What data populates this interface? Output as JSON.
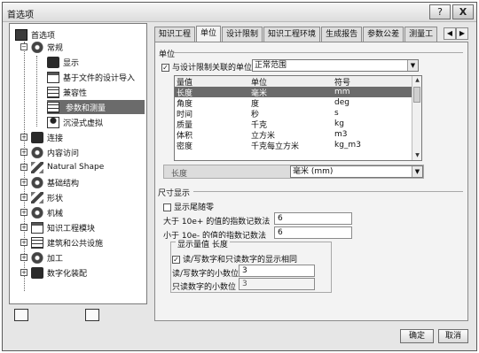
{
  "window": {
    "title": "首选项"
  },
  "tree": {
    "items": [
      {
        "label": "首选项"
      },
      {
        "label": "常规"
      },
      {
        "label": "显示"
      },
      {
        "label": "基于文件的设计导入"
      },
      {
        "label": "兼容性"
      },
      {
        "label": "参数和测量"
      },
      {
        "label": "沉浸式虚拟"
      },
      {
        "label": "连接"
      },
      {
        "label": "内容访问"
      },
      {
        "label": "Natural Shape"
      },
      {
        "label": "基础结构"
      },
      {
        "label": "形状"
      },
      {
        "label": "机械"
      },
      {
        "label": "知识工程模块"
      },
      {
        "label": "建筑和公共设施"
      },
      {
        "label": "加工"
      },
      {
        "label": "数字化装配"
      }
    ]
  },
  "tabs": [
    {
      "label": "知识工程"
    },
    {
      "label": "单位"
    },
    {
      "label": "设计限制"
    },
    {
      "label": "知识工程环境"
    },
    {
      "label": "生成报告"
    },
    {
      "label": "参数公差"
    },
    {
      "label": "测量工"
    }
  ],
  "units": {
    "group_title": "单位",
    "related_label": "与设计限制关联的单位",
    "related_value": "正常范围",
    "headers": {
      "quantity": "量值",
      "unit": "单位",
      "symbol": "符号"
    },
    "rows": [
      {
        "quantity": "长度",
        "unit": "毫米",
        "symbol": "mm"
      },
      {
        "quantity": "角度",
        "unit": "度",
        "symbol": "deg"
      },
      {
        "quantity": "时间",
        "unit": "秒",
        "symbol": "s"
      },
      {
        "quantity": "质量",
        "unit": "千克",
        "symbol": "kg"
      },
      {
        "quantity": "体积",
        "unit": "立方米",
        "symbol": "m3"
      },
      {
        "quantity": "密度",
        "unit": "千克每立方米",
        "symbol": "kg_m3"
      }
    ],
    "selected_quantity": "长度",
    "selected_unit": "毫米 (mm)"
  },
  "dimension": {
    "group_title": "尺寸显示",
    "trailing_zeros_label": "显示尾随零",
    "exp_large_label": "大于 10e+ 的值的指数记数法",
    "exp_large_value": "6",
    "exp_small_label": "小于 10e- 的值的指数记数法",
    "exp_small_value": "6",
    "subgroup_title": "显示量值 长度",
    "same_decimals_label": "读/写数字和只读数字的显示相同",
    "rw_decimals_label": "读/写数字的小数位",
    "rw_decimals_value": "3",
    "ro_decimals_label": "只读数字的小数位",
    "ro_decimals_value": "3"
  },
  "buttons": {
    "ok": "确定",
    "cancel": "取消"
  },
  "icons": {
    "help": "?",
    "close": "X",
    "tab_prev": "◀",
    "tab_next": "▶",
    "dropdown": "▼",
    "checkmark": "✓"
  }
}
